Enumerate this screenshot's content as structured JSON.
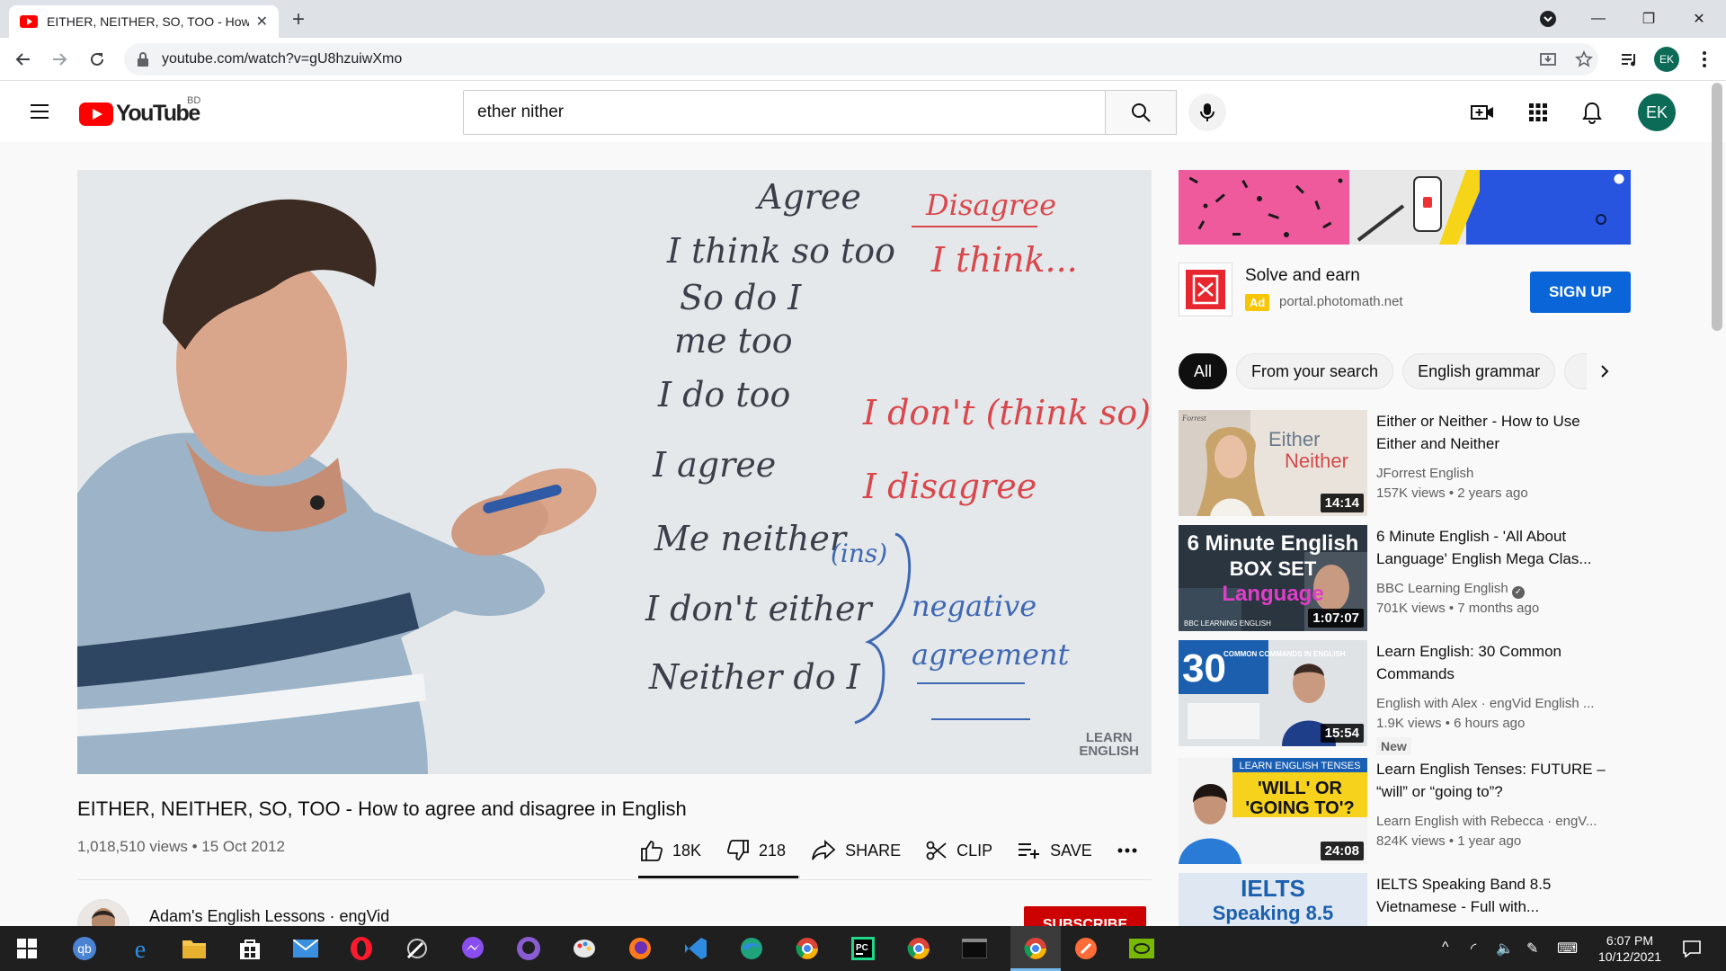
{
  "browser": {
    "tab_title": "EITHER, NEITHER, SO, TOO - How to agree and disagree in English",
    "url": "youtube.com/watch?v=gU8hzuiwXmo",
    "profile_initials": "EK"
  },
  "masthead": {
    "logo_text": "YouTube",
    "country_code": "BD",
    "search_value": "ether nither",
    "avatar_initials": "EK"
  },
  "player": {
    "whiteboard": {
      "agree_header": "Agree",
      "disagree_header": "Disagree",
      "lines": [
        "I think so too",
        "So do I",
        "me too",
        "I do too",
        "I agree",
        "Me neither",
        "I don't either",
        "Neither do I"
      ],
      "red_lines": [
        "I think...",
        "I don't (think so)",
        "I disagree"
      ],
      "ins_note": "(ins)",
      "brace_note_1": "negative",
      "brace_note_2": "agreement"
    },
    "watermark_1": "LEARN",
    "watermark_2": "ENGLISH"
  },
  "video": {
    "title": "EITHER, NEITHER, SO, TOO - How to agree and disagree in English",
    "views": "1,018,510 views",
    "date": "15 Oct 2012",
    "likes": "18K",
    "dislikes": "218",
    "like_ratio": 0.988,
    "share_label": "SHARE",
    "clip_label": "CLIP",
    "save_label": "SAVE",
    "channel_name": "Adam's English Lessons · engVid",
    "subscribe_label": "SUBSCRIBE"
  },
  "ad": {
    "title": "Solve and earn",
    "badge": "Ad",
    "url": "portal.photomath.net",
    "cta": "SIGN UP"
  },
  "chips": [
    "All",
    "From your search",
    "English grammar"
  ],
  "recommendations": [
    {
      "title": "Either or Neither - How to Use Either and Neither",
      "channel": "JForrest English",
      "stats": "157K views • 2 years ago",
      "duration": "14:14",
      "thumb_text_1": "Either",
      "thumb_text_2": "Neither",
      "thumb_logo": "Forrest"
    },
    {
      "title": "6 Minute English - 'All About Language' English Mega Clas...",
      "channel": "BBC Learning English",
      "stats": "701K views • 7 months ago",
      "duration": "1:07:07",
      "thumb_text_1": "6 Minute English",
      "thumb_text_2": "BOX SET",
      "thumb_text_3": "Language",
      "thumb_text_4": "BBC LEARNING ENGLISH"
    },
    {
      "title": "Learn English: 30 Common Commands",
      "channel": "English with Alex · engVid English ...",
      "stats": "1.9K views • 6 hours ago",
      "duration": "15:54",
      "badge": "New",
      "thumb_text_1": "30",
      "thumb_text_2": "COMMON COMMANDS IN ENGLISH"
    },
    {
      "title": "Learn English Tenses: FUTURE – “will” or “going to”?",
      "channel": "Learn English with Rebecca · engV...",
      "stats": "824K views • 1 year ago",
      "duration": "24:08",
      "thumb_text_1": "LEARN ENGLISH TENSES",
      "thumb_text_2": "'WILL' OR",
      "thumb_text_3": "'GOING TO'?"
    },
    {
      "title": "IELTS Speaking Band 8.5 Vietnamese - Full with...",
      "thumb_text_1": "IELTS",
      "thumb_text_2": "Speaking 8.5"
    }
  ],
  "taskbar": {
    "time": "6:07 PM",
    "date": "10/12/2021"
  },
  "colors": {
    "youtube_red": "#ff0000",
    "subscribe_red": "#cc0000",
    "signup_blue": "#0a66d8",
    "avatar_green": "#0b6b57"
  }
}
